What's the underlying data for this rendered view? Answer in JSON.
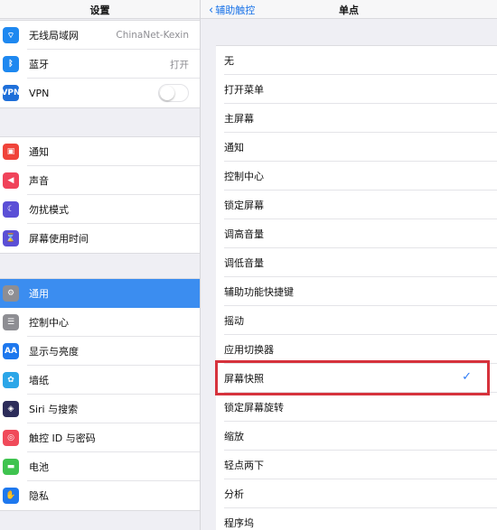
{
  "left": {
    "title": "设置",
    "group1": [
      {
        "label": "无线局域网",
        "value": "ChinaNet-Kexin",
        "icon": "wifi-icon",
        "color": "#1e88f0",
        "glyph": "⌔"
      },
      {
        "label": "蓝牙",
        "value": "打开",
        "icon": "bluetooth-icon",
        "color": "#1e88f0",
        "glyph": "ᛒ"
      },
      {
        "label": "VPN",
        "icon": "vpn-icon",
        "color": "#1e6fd9",
        "glyph": "VPN",
        "toggle": false
      }
    ],
    "group2": [
      {
        "label": "通知",
        "icon": "notifications-icon",
        "color": "#f0433a",
        "glyph": "▣"
      },
      {
        "label": "声音",
        "icon": "sounds-icon",
        "color": "#f0435a",
        "glyph": "◀"
      },
      {
        "label": "勿扰模式",
        "icon": "do-not-disturb-icon",
        "color": "#5b4fd6",
        "glyph": "☾"
      },
      {
        "label": "屏幕使用时间",
        "icon": "screen-time-icon",
        "color": "#5b4fd6",
        "glyph": "⌛"
      }
    ],
    "group3": [
      {
        "label": "通用",
        "icon": "gear-icon",
        "color": "#8e8e93",
        "glyph": "⚙",
        "selected": true
      },
      {
        "label": "控制中心",
        "icon": "control-center-icon",
        "color": "#8e8e93",
        "glyph": "☰"
      },
      {
        "label": "显示与亮度",
        "icon": "display-brightness-icon",
        "color": "#1e78ee",
        "glyph": "AA"
      },
      {
        "label": "墙纸",
        "icon": "wallpaper-icon",
        "color": "#2ba6e8",
        "glyph": "✿"
      },
      {
        "label": "Siri 与搜索",
        "icon": "siri-icon",
        "color": "#2c2c5a",
        "glyph": "◈"
      },
      {
        "label": "触控 ID 与密码",
        "icon": "touch-id-icon",
        "color": "#f04a5a",
        "glyph": "◎"
      },
      {
        "label": "电池",
        "icon": "battery-icon",
        "color": "#3fc34f",
        "glyph": "▬"
      },
      {
        "label": "隐私",
        "icon": "privacy-icon",
        "color": "#1e78ee",
        "glyph": "✋"
      }
    ]
  },
  "right": {
    "back_label": "辅助触控",
    "title": "单点",
    "options": [
      {
        "label": "无"
      },
      {
        "label": "打开菜单"
      },
      {
        "label": "主屏幕"
      },
      {
        "label": "通知"
      },
      {
        "label": "控制中心"
      },
      {
        "label": "锁定屏幕"
      },
      {
        "label": "调高音量"
      },
      {
        "label": "调低音量"
      },
      {
        "label": "辅助功能快捷键"
      },
      {
        "label": "摇动"
      },
      {
        "label": "应用切换器"
      },
      {
        "label": "屏幕快照",
        "checked": true
      },
      {
        "label": "锁定屏幕旋转"
      },
      {
        "label": "缩放"
      },
      {
        "label": "轻点两下"
      },
      {
        "label": "分析"
      },
      {
        "label": "程序坞"
      }
    ],
    "check_glyph": "✓"
  },
  "colors": {
    "accent": "#3b8df0",
    "highlight": "#d6323c",
    "check": "#2f7cf6"
  }
}
